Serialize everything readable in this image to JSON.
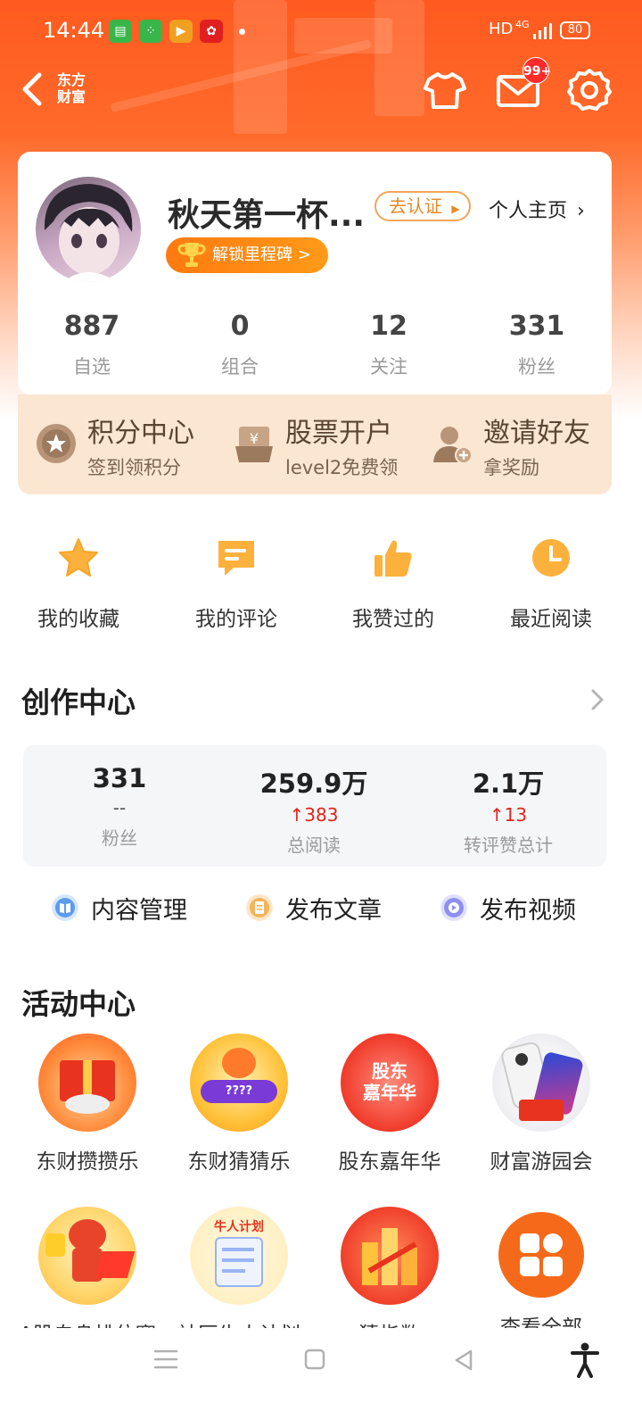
{
  "status_bar": {
    "time": "14:44",
    "network": "HD",
    "signal_label": "4G",
    "battery": "80"
  },
  "header": {
    "logo_line1": "东方",
    "logo_line2": "财富",
    "mail_badge": "99+"
  },
  "profile": {
    "username": "秋天第一杯...",
    "verify_label": "去认证",
    "homepage_label": "个人主页",
    "milestone_label": "解锁里程碑 >",
    "stats": [
      {
        "value": "887",
        "label": "自选"
      },
      {
        "value": "0",
        "label": "组合"
      },
      {
        "value": "12",
        "label": "关注"
      },
      {
        "value": "331",
        "label": "粉丝"
      }
    ]
  },
  "perks": [
    {
      "title": "积分中心",
      "subtitle": "签到领积分",
      "icon": "star-badge-icon"
    },
    {
      "title": "股票开户",
      "subtitle": "level2免费领",
      "icon": "yen-box-icon"
    },
    {
      "title": "邀请好友",
      "subtitle": "拿奖励",
      "icon": "add-user-icon"
    }
  ],
  "quick_links": [
    {
      "label": "我的收藏",
      "icon": "star-icon"
    },
    {
      "label": "我的评论",
      "icon": "comment-icon"
    },
    {
      "label": "我赞过的",
      "icon": "thumbs-up-icon"
    },
    {
      "label": "最近阅读",
      "icon": "clock-icon"
    }
  ],
  "creation": {
    "title": "创作中心",
    "stats": [
      {
        "value": "331",
        "delta": "--",
        "label": "粉丝"
      },
      {
        "value": "259.9万",
        "delta": "↑383",
        "label": "总阅读"
      },
      {
        "value": "2.1万",
        "delta": "↑13",
        "label": "转评赞总计"
      }
    ],
    "actions": [
      {
        "label": "内容管理",
        "color": "#5b9cf0"
      },
      {
        "label": "发布文章",
        "color": "#f5b35a"
      },
      {
        "label": "发布视频",
        "color": "#8f8ff0"
      }
    ]
  },
  "activities": {
    "title": "活动中心",
    "items": [
      {
        "label": "东财攒攒乐"
      },
      {
        "label": "东财猜猜乐",
        "badge": "????"
      },
      {
        "label": "股东嘉年华",
        "badge_line1": "股东",
        "badge_line2": "嘉年华"
      },
      {
        "label": "财富游园会"
      },
      {
        "label": "A股自身排位赛",
        "badge": ""
      },
      {
        "label": "社区牛人计划",
        "badge": "牛人计划"
      },
      {
        "label": "猜指数"
      },
      {
        "label": "查看全部"
      }
    ]
  },
  "colors": {
    "brand": "#ff5a1f",
    "accent_orange": "#ff8a1a",
    "rise_red": "#e2231a"
  }
}
